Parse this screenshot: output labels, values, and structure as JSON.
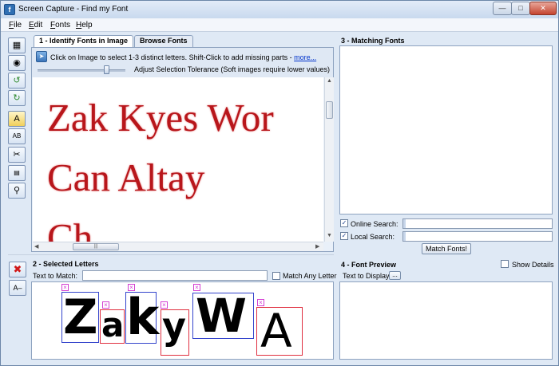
{
  "window": {
    "title": "Screen Capture - Find my Font"
  },
  "menu": [
    {
      "label": "File",
      "mnemonic": "F",
      "rest": "ile"
    },
    {
      "label": "Edit",
      "mnemonic": "E",
      "rest": "dit"
    },
    {
      "label": "Fonts",
      "mnemonic": "F",
      "rest": "onts"
    },
    {
      "label": "Help",
      "mnemonic": "H",
      "rest": "elp"
    }
  ],
  "identify": {
    "tabs": [
      "1 - Identify Fonts in Image",
      "Browse Fonts"
    ],
    "hint": "Click on Image to select 1-3 distinct letters. Shift-Click to add missing parts -",
    "more_link": "more...",
    "tolerance_label": "Adjust Selection Tolerance (Soft images require lower values)",
    "tolerance_value": 0.78,
    "specimen_lines": [
      "Zak Kyes Wor",
      "Can Altay",
      "Ch"
    ]
  },
  "selected": {
    "title": "2 - Selected Letters",
    "text_to_match_label": "Text to Match:",
    "text_to_match_value": "",
    "match_any_letter_label": "Match Any Letter",
    "match_any_letter_checked": false,
    "letters": [
      "Z",
      "a",
      "k",
      "y",
      "W",
      "A"
    ]
  },
  "matching": {
    "title": "3 - Matching Fonts",
    "online_search_label": "Online Search:",
    "online_search_checked": true,
    "online_search_value": "",
    "local_search_label": "Local Search:",
    "local_search_checked": true,
    "local_search_value": "",
    "match_button": "Match Fonts!"
  },
  "preview": {
    "title": "4 - Font Preview",
    "show_details_label": "Show Details",
    "show_details_checked": false,
    "text_to_display_label": "Text to Display:",
    "dots_button": "..."
  },
  "colors": {
    "specimen_red": "#b8161b",
    "box_blue": "#3344cc",
    "box_red": "#e03040",
    "accent": "#2f6fb3"
  },
  "icons": {
    "app": "app-icon",
    "toolbar": [
      "open-image-icon",
      "camera-icon",
      "rotate-left-icon",
      "rotate-right-icon",
      "text-detect-icon",
      "font-compare-icon",
      "scissors-icon",
      "ruler-icon",
      "zoom-icon"
    ],
    "selection_toolbar": [
      "delete-red-x-icon",
      "remove-letter-icon"
    ]
  }
}
